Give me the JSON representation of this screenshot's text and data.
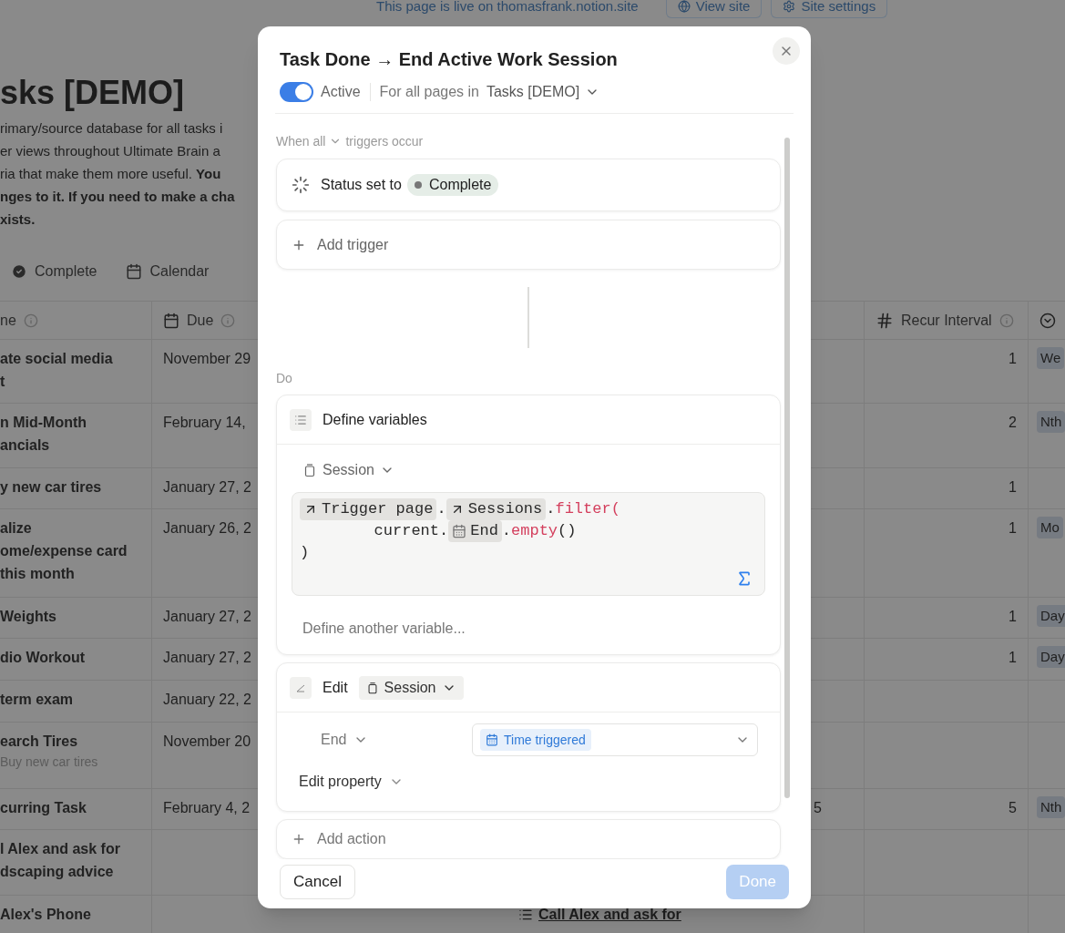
{
  "top_bar": {
    "notice": "This page is live on thomasfrank.notion.site",
    "buttons": [
      "View site",
      "Site settings"
    ]
  },
  "page": {
    "title": "sks [DEMO]",
    "description": [
      "rimary/source database for all tasks i",
      "er views throughout Ultimate Brain a",
      "ria that make them more useful. **You**",
      "**nges to it. If you need to make a cha**",
      "**xists.**"
    ]
  },
  "views": [
    {
      "label": "Complete"
    },
    {
      "label": "Calendar"
    }
  ],
  "table": {
    "columns": [
      {
        "kind": "title",
        "label": "ne",
        "info": true
      },
      {
        "kind": "date",
        "label": "Due",
        "info": true
      },
      {
        "kind": "number",
        "label": "Recur Interval",
        "info": true
      },
      {
        "kind": "select"
      }
    ],
    "rows": [
      {
        "name": "ate social media\nt",
        "due": "November 29",
        "recur_interval": "1",
        "recur_type": "We"
      },
      {
        "name": "n Mid-Month\nancials",
        "due": "February 14,",
        "recur_interval": "2",
        "recur_type": "Nth"
      },
      {
        "name": "y new car tires",
        "due": "January 27, 2",
        "recur_interval": "1"
      },
      {
        "name": "alize\nome/expense card\nthis month",
        "due": "January 26, 2",
        "recur_interval": "1",
        "recur_type": "Mo"
      },
      {
        "name": "Weights",
        "due": "January 27, 2",
        "recur_interval": "1",
        "recur_type": "Day"
      },
      {
        "name": "dio Workout",
        "due": "January 27, 2",
        "recur_interval": "1",
        "recur_type": "Day"
      },
      {
        "name": "term exam",
        "due": "January 22, 2"
      },
      {
        "name": "earch Tires",
        "subtitle": "Buy new car tires",
        "due": "November 20"
      },
      {
        "name": "curring Task",
        "due": "February 4, 2",
        "value": "5",
        "recur_interval": "5",
        "recur_type": "Nth"
      },
      {
        "name": "l Alex and ask for\ndscaping advice"
      },
      {
        "name": "Alex's Phone",
        "relation": "Call Alex and ask for"
      }
    ]
  },
  "modal": {
    "title": "Task Done → End Active Work Session",
    "active": {
      "on": true,
      "label": "Active"
    },
    "scope_label": "For all pages in",
    "scope_db": "Tasks [DEMO]",
    "when": {
      "mode": "When all",
      "suffix": "triggers occur"
    },
    "triggers": [
      {
        "kind": "status",
        "label": "Status set to",
        "value": "Complete"
      },
      {
        "kind": "add",
        "label": "Add trigger"
      }
    ],
    "do_label": "Do",
    "actions": [
      {
        "kind": "define",
        "title": "Define variables",
        "variable": "Session",
        "formula": [
          [
            {
              "kind": "relation",
              "text": "Trigger page"
            },
            {
              "kind": "plain",
              "text": "."
            },
            {
              "kind": "relation",
              "text": "Sessions"
            },
            {
              "kind": "plain",
              "text": "."
            },
            {
              "kind": "fn",
              "text": "filter("
            }
          ],
          [
            {
              "kind": "plain",
              "text": "        current."
            },
            {
              "kind": "date",
              "text": "End"
            },
            {
              "kind": "plain",
              "text": "."
            },
            {
              "kind": "fn",
              "text": "empty"
            },
            {
              "kind": "plain",
              "text": "()"
            }
          ],
          [
            {
              "kind": "plain",
              "text": ")"
            }
          ]
        ],
        "add_label": "Define another variable..."
      },
      {
        "kind": "edit",
        "title": "Edit",
        "target": "Session",
        "property": "End",
        "value": "Time triggered",
        "add_label": "Edit property"
      },
      {
        "kind": "add",
        "title": "Add action"
      }
    ],
    "cancel": "Cancel",
    "done": {
      "label": "Done",
      "disabled": true
    }
  }
}
